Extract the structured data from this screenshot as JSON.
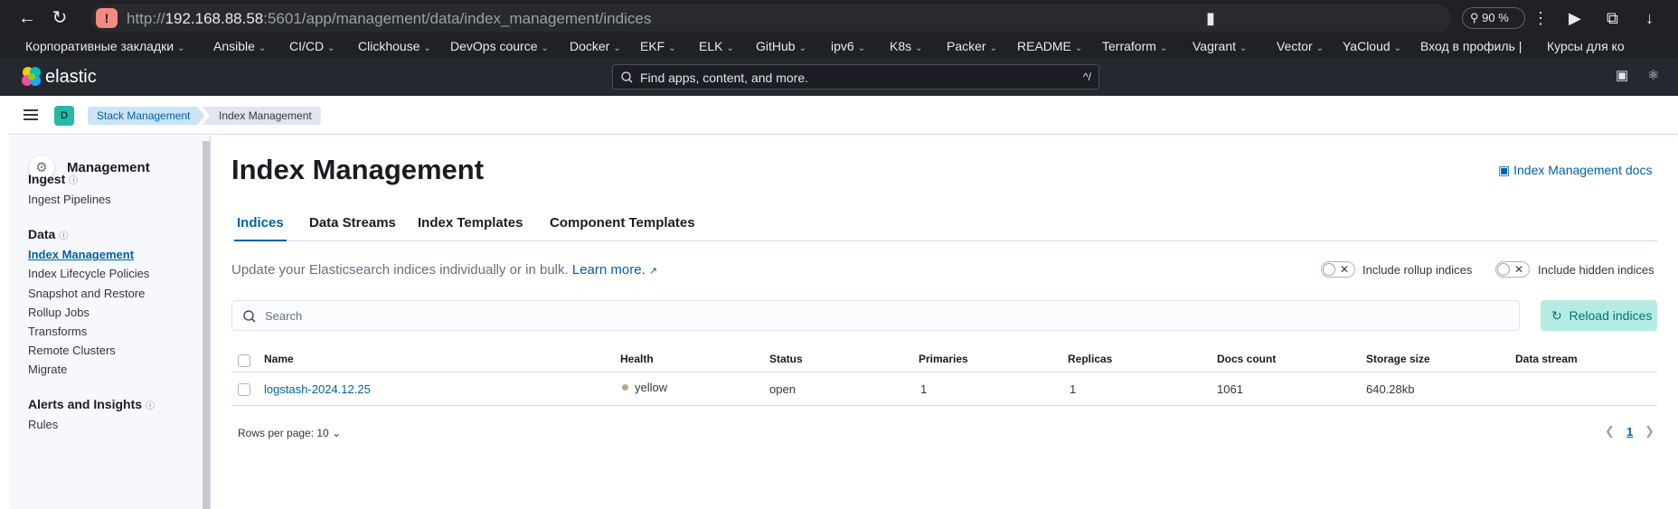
{
  "browser": {
    "url_scheme": "http://",
    "url_host": "192.168.88.58",
    "url_rest": ":5601/app/management/data/index_management/indices",
    "zoom": "90 %",
    "bookmarks": [
      {
        "label": "Корпоративные закладки"
      },
      {
        "label": "Ansible"
      },
      {
        "label": "CI/CD"
      },
      {
        "label": "Clickhouse"
      },
      {
        "label": "DevOps cource"
      },
      {
        "label": "Docker"
      },
      {
        "label": "EKF"
      },
      {
        "label": "ELK"
      },
      {
        "label": "GitHub"
      },
      {
        "label": "ipv6"
      },
      {
        "label": "K8s"
      },
      {
        "label": "Packer"
      },
      {
        "label": "README"
      },
      {
        "label": "Terraform"
      },
      {
        "label": "Vagrant"
      },
      {
        "label": "Vector"
      },
      {
        "label": "YaCloud"
      },
      {
        "label": "Вход в профиль |"
      },
      {
        "label": "Курсы для ко"
      }
    ]
  },
  "header": {
    "logo_text": "elastic",
    "search_placeholder": "Find apps, content, and more.",
    "search_shortcut": "^/"
  },
  "breadcrumbs": {
    "space": "D",
    "items": [
      "Stack Management",
      "Index Management"
    ]
  },
  "sidenav": {
    "title": "Management",
    "groups": [
      {
        "label": "Ingest",
        "items": [
          "Ingest Pipelines"
        ]
      },
      {
        "label": "Data",
        "items": [
          "Index Management",
          "Index Lifecycle Policies",
          "Snapshot and Restore",
          "Rollup Jobs",
          "Transforms",
          "Remote Clusters",
          "Migrate"
        ]
      },
      {
        "label": "Alerts and Insights",
        "items": [
          "Rules"
        ]
      }
    ]
  },
  "main": {
    "title": "Index Management",
    "docs_link": "Index Management docs",
    "tabs": [
      "Indices",
      "Data Streams",
      "Index Templates",
      "Component Templates"
    ],
    "intro_text": "Update your Elasticsearch indices individually or in bulk.",
    "intro_link": "Learn more.",
    "toggle_rollup": "Include rollup indices",
    "toggle_hidden": "Include hidden indices",
    "search_placeholder": "Search",
    "reload_label": "Reload indices",
    "table": {
      "columns": [
        "Name",
        "Health",
        "Status",
        "Primaries",
        "Replicas",
        "Docs count",
        "Storage size",
        "Data stream"
      ],
      "rows": [
        {
          "name": "logstash-2024.12.25",
          "health": "yellow",
          "status": "open",
          "primaries": "1",
          "replicas": "1",
          "docs_count": "1061",
          "storage_size": "640.28kb",
          "data_stream": ""
        }
      ]
    },
    "rows_per_page": "Rows per page: 10",
    "current_page": "1"
  },
  "colors": {
    "health_yellow": "#b9a888",
    "accent": "#0061a6"
  }
}
